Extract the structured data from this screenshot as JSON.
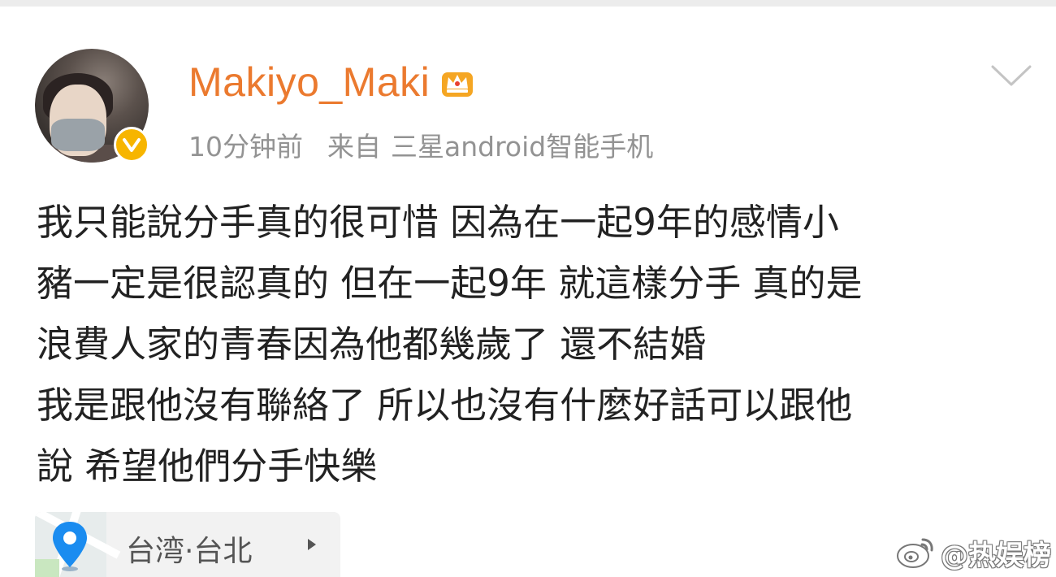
{
  "post": {
    "username": "Makiyo_Maki",
    "meta": {
      "time": "10分钟前",
      "source_prefix": "来自",
      "source_device": "三星android智能手机"
    },
    "text_lines": [
      "我只能說分手真的很可惜 因為在一起9年的感情小",
      "豬一定是很認真的 但在一起9年 就這樣分手 真的是",
      "浪費人家的青春因為他都幾歲了 還不結婚",
      "我是跟他沒有聯絡了 所以也沒有什麼好話可以跟他",
      "說 希望他們分手快樂"
    ],
    "location": "台湾·台北"
  },
  "watermark": {
    "text": "@热娱榜"
  },
  "colors": {
    "username": "#eb7a2f",
    "meta_text": "#939393",
    "body_text": "#222222",
    "verified_badge": "#f7b500",
    "location_pin": "#1a8cf0",
    "crown": "#f5a623"
  },
  "icons": {
    "verified": "verified-v-icon",
    "membership": "crown-icon",
    "more": "chevron-down-icon",
    "location": "location-pin-icon",
    "location_arrow": "triangle-right-icon",
    "watermark_logo": "weibo-logo-icon"
  }
}
